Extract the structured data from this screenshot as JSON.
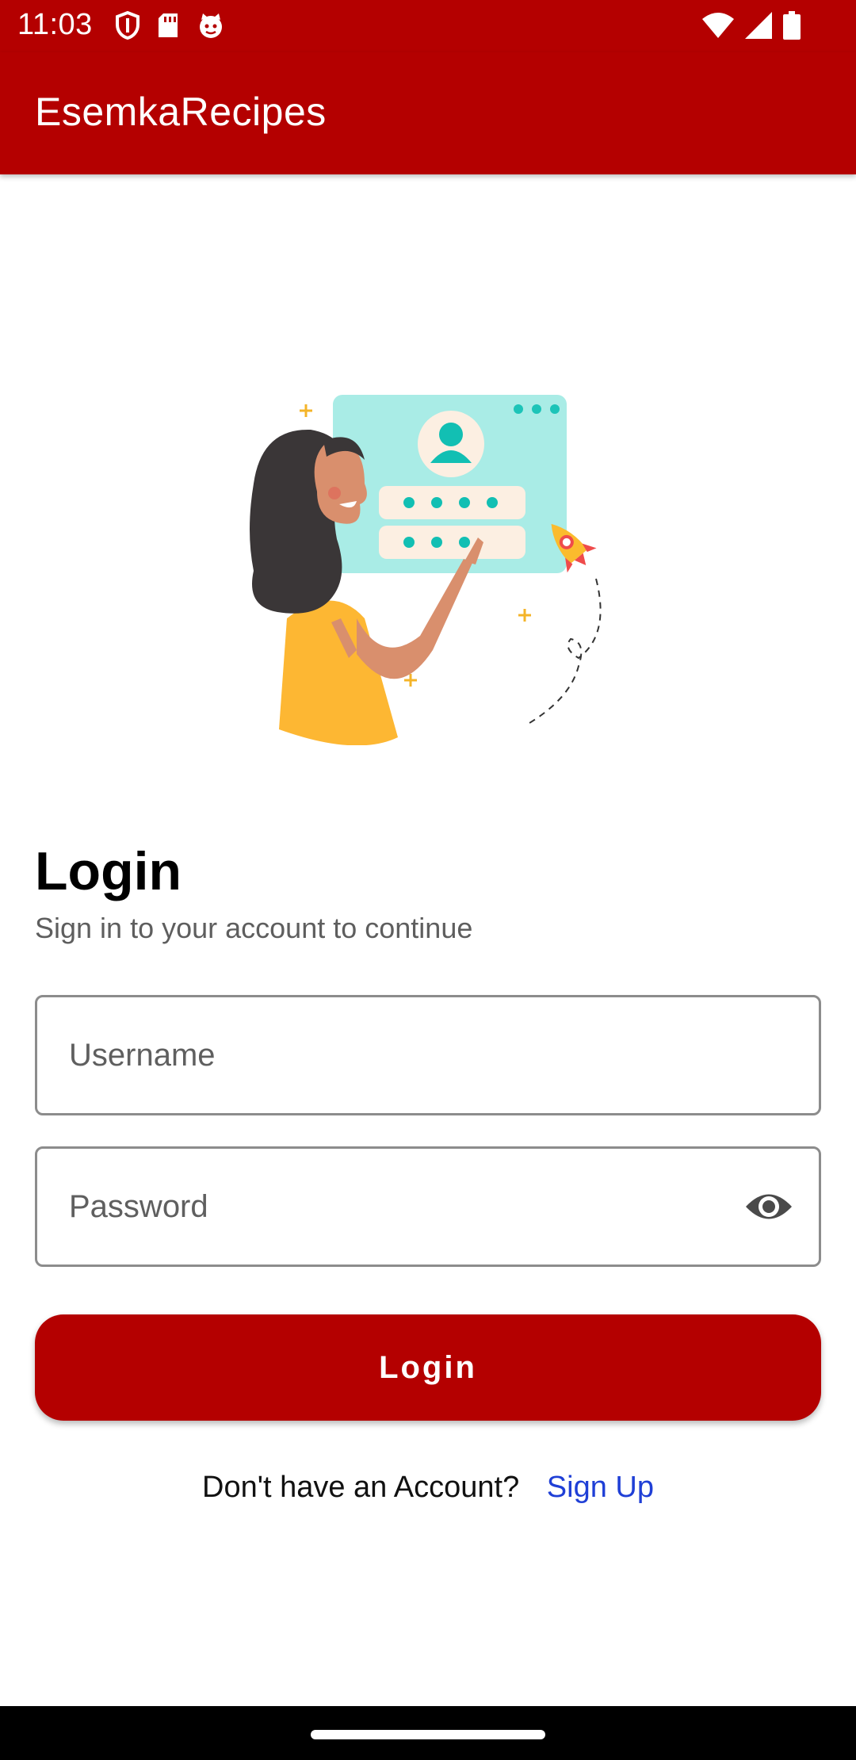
{
  "status_bar": {
    "time": "11:03",
    "left_icons": [
      "shield-icon",
      "sd-card-icon",
      "cat-face-icon"
    ],
    "right_icons": [
      "wifi-icon",
      "signal-icon",
      "battery-icon"
    ]
  },
  "app_bar": {
    "title": "EsemkaRecipes",
    "color": "#b40000"
  },
  "login": {
    "title": "Login",
    "subtitle": "Sign in to your account to continue",
    "username": {
      "placeholder": "Username",
      "value": ""
    },
    "password": {
      "placeholder": "Password",
      "value": ""
    },
    "button_label": "Login",
    "signup_question": "Don't have an Account?",
    "signup_link": "Sign Up"
  },
  "colors": {
    "accent": "#b40000",
    "link": "#1f3fd6"
  }
}
